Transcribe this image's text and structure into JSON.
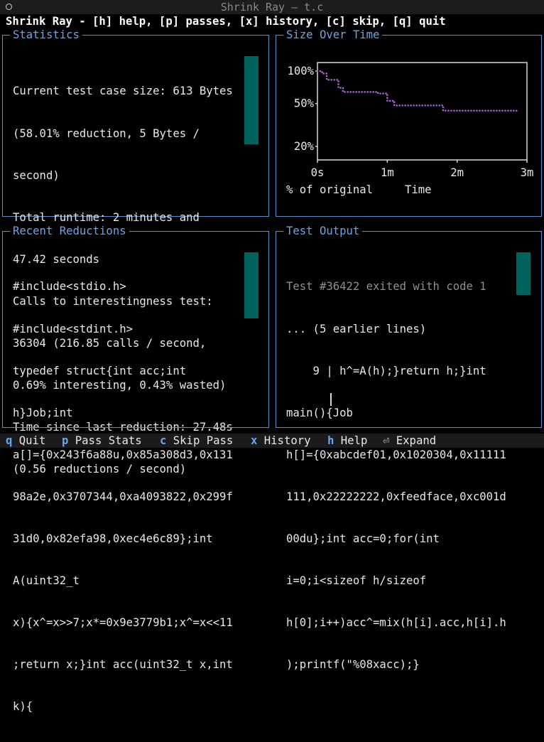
{
  "window": {
    "title": "Shrink Ray — t.c"
  },
  "header": {
    "text": "Shrink Ray - [h] help, [p] passes, [x] history, [c] skip, [q] quit"
  },
  "statistics": {
    "title": "Statistics",
    "lines": [
      "Current test case size: 613 Bytes",
      "(58.01% reduction, 5 Bytes /",
      "second)",
      "Total runtime: 2 minutes and",
      "47.42 seconds",
      "Calls to interestingness test:",
      "36304 (216.85 calls / second,",
      "0.69% interesting, 0.43% wasted)",
      "Time since last reduction: 27.48s",
      "(0.56 reductions / second)"
    ]
  },
  "size_over_time": {
    "title": "Size Over Time",
    "chart_data": {
      "type": "line",
      "title": "",
      "xlabel": "Time",
      "ylabel": "% of original",
      "x_unit": "seconds",
      "xlim": [
        0,
        180
      ],
      "ylim": [
        15,
        120
      ],
      "yscale": "log",
      "x_ticks": [
        {
          "value": 0,
          "label": "0s"
        },
        {
          "value": 60,
          "label": "1m"
        },
        {
          "value": 120,
          "label": "2m"
        },
        {
          "value": 180,
          "label": "3m"
        }
      ],
      "y_ticks": [
        {
          "value": 100,
          "label": "100%"
        },
        {
          "value": 50,
          "label": "50%"
        },
        {
          "value": 20,
          "label": "20%"
        }
      ],
      "color": "#b15fe0",
      "grid": false,
      "series": [
        {
          "x": [
            0,
            4,
            8,
            13,
            18,
            22,
            28,
            40,
            52,
            60,
            66,
            80,
            95,
            105,
            108,
            120,
            140,
            160,
            171
          ],
          "y": [
            100,
            95,
            83,
            83,
            70,
            64,
            64,
            64,
            62,
            53,
            48,
            48,
            48,
            48,
            43,
            43,
            43,
            43,
            42
          ]
        }
      ]
    }
  },
  "recent_reductions": {
    "title": "Recent Reductions",
    "lines": [
      "#include<stdio.h>",
      "#include<stdint.h>",
      "typedef struct{int acc;int",
      "h}Job;int",
      "a[]={0x243f6a88u,0x85a308d3,0x131",
      "98a2e,0x3707344,0xa4093822,0x299f",
      "31d0,0x82efa98,0xec4e6c89};int",
      "A(uint32_t",
      "x){x^=x>>7;x*=0x9e3779b1;x^=x<<11",
      ";return x;}int acc(uint32_t x,int",
      "k){"
    ]
  },
  "test_output": {
    "title": "Test Output",
    "status": "Test #36422 exited with code 1",
    "lines": [
      "... (5 earlier lines)",
      "    9 | h^=A(h);}return h;}int",
      "main(){Job",
      "h[]={0xabcdef01,0x1020304,0x11111",
      "111,0x22222222,0xfeedface,0xc001d",
      "00du};int acc=0;for(int",
      "i=0;i<sizeof h/sizeof",
      "h[0];i++)acc^=mix(h[i].acc,h[i].h",
      ");printf(\"%08xacc);}"
    ]
  },
  "footer": {
    "items": [
      {
        "key": "q",
        "label": "Quit"
      },
      {
        "key": "p",
        "label": "Pass Stats"
      },
      {
        "key": "c",
        "label": "Skip Pass"
      },
      {
        "key": "x",
        "label": "History"
      },
      {
        "key": "h",
        "label": "Help"
      },
      {
        "key": "⏎",
        "label": "Expand"
      }
    ]
  }
}
